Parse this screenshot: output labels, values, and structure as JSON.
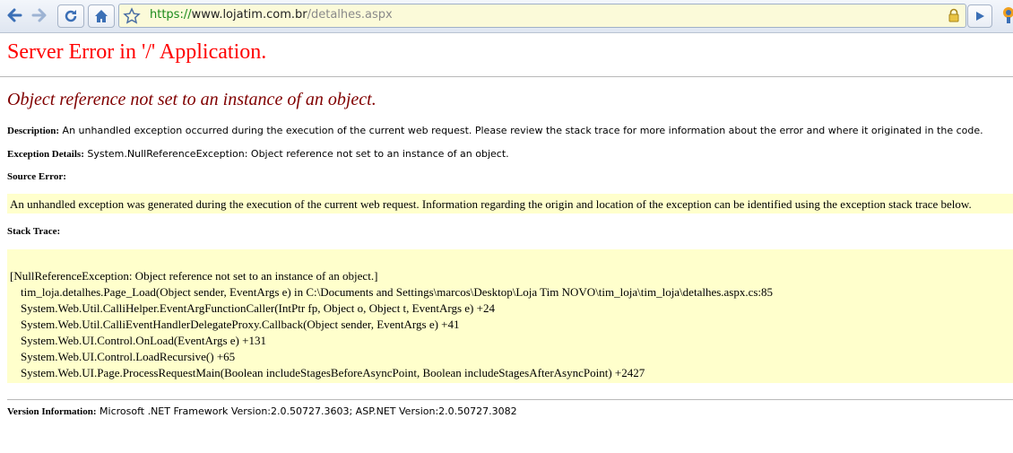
{
  "browser": {
    "url_scheme": "https://",
    "url_host": "www.lojatim.com.br",
    "url_path": "/detalhes.aspx",
    "urlbar_color": "#fbfad9"
  },
  "error_page": {
    "title": "Server Error in '/' Application.",
    "message": "Object reference not set to an instance of an object.",
    "description_label": "Description:",
    "description_text": "An unhandled exception occurred during the execution of the current web request. Please review the stack trace for more information about the error and where it originated in the code.",
    "exception_label": "Exception Details:",
    "exception_text": "System.NullReferenceException: Object reference not set to an instance of an object.",
    "source_error_label": "Source Error:",
    "source_error_text": "An unhandled exception was generated during the execution of the current web request. Information regarding the origin and location of the exception can be identified using the exception stack trace below.",
    "stack_trace_label": "Stack Trace:",
    "stack_trace": [
      "[NullReferenceException: Object reference not set to an instance of an object.]",
      "tim_loja.detalhes.Page_Load(Object sender, EventArgs e) in C:\\Documents and Settings\\marcos\\Desktop\\Loja Tim NOVO\\tim_loja\\tim_loja\\detalhes.aspx.cs:85",
      "System.Web.Util.CalliHelper.EventArgFunctionCaller(IntPtr fp, Object o, Object t, EventArgs e) +24",
      "System.Web.Util.CalliEventHandlerDelegateProxy.Callback(Object sender, EventArgs e) +41",
      "System.Web.UI.Control.OnLoad(EventArgs e) +131",
      "System.Web.UI.Control.LoadRecursive() +65",
      "System.Web.UI.Page.ProcessRequestMain(Boolean includeStagesBeforeAsyncPoint, Boolean includeStagesAfterAsyncPoint) +2427"
    ],
    "version_label": "Version Information:",
    "version_text": "Microsoft .NET Framework Version:2.0.50727.3603; ASP.NET Version:2.0.50727.3082",
    "colors": {
      "title": "#ff0000",
      "message": "#800000",
      "highlight": "#ffffcc"
    }
  }
}
